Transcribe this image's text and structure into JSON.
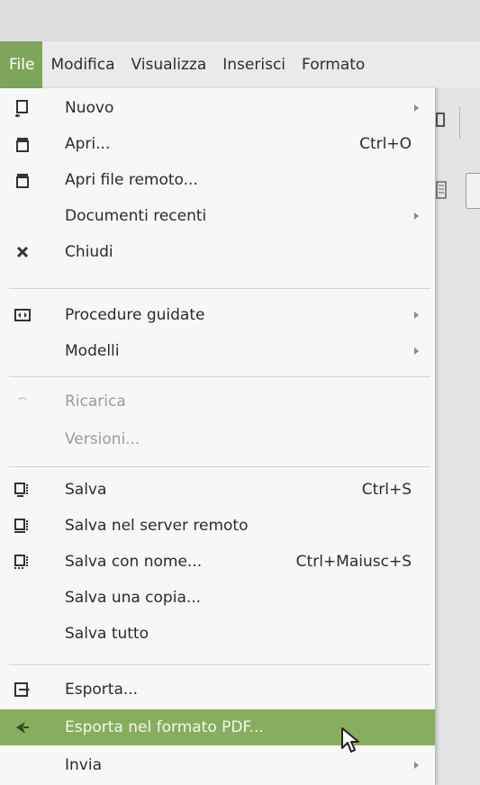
{
  "menubar": {
    "items": [
      {
        "label": "File",
        "active": true
      },
      {
        "label": "Modifica"
      },
      {
        "label": "Visualizza"
      },
      {
        "label": "Inserisci"
      },
      {
        "label": "Formato"
      }
    ]
  },
  "file_menu": {
    "items": [
      {
        "label": "Nuovo",
        "icon": "new-document-icon",
        "submenu": true
      },
      {
        "label": "Apri...",
        "icon": "open-folder-icon",
        "shortcut": "Ctrl+O"
      },
      {
        "label": "Apri file remoto...",
        "icon": "open-remote-icon"
      },
      {
        "label": "Documenti recenti",
        "submenu": true
      },
      {
        "label": "Chiudi",
        "icon": "close-icon"
      },
      {
        "label": "Procedure guidate",
        "icon": "wizard-icon",
        "submenu": true
      },
      {
        "label": "Modelli",
        "submenu": true
      },
      {
        "label": "Ricarica",
        "icon": "reload-icon",
        "disabled": true
      },
      {
        "label": "Versioni...",
        "disabled": true
      },
      {
        "label": "Salva",
        "icon": "save-icon",
        "shortcut": "Ctrl+S"
      },
      {
        "label": "Salva nel server remoto",
        "icon": "save-remote-icon"
      },
      {
        "label": "Salva con nome...",
        "icon": "save-as-icon",
        "shortcut": "Ctrl+Maiusc+S"
      },
      {
        "label": "Salva una copia..."
      },
      {
        "label": "Salva tutto"
      },
      {
        "label": "Esporta...",
        "icon": "export-icon"
      },
      {
        "label": "Esporta nel formato PDF...",
        "icon": "export-pdf-icon",
        "highlighted": true
      },
      {
        "label": "Invia",
        "submenu": true
      }
    ]
  },
  "colors": {
    "accent": "#87ad5f",
    "menubar_active": "#7ea65a",
    "menu_bg": "#f7f7f7",
    "disabled_text": "#9b9b9b"
  }
}
